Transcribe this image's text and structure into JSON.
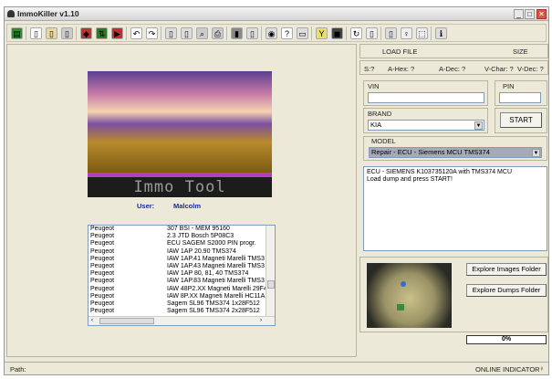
{
  "window": {
    "title": "ImmoKiller v1.10",
    "minimize": "_",
    "maximize": "□",
    "close": "✕"
  },
  "toolbar": {
    "icons": [
      "memory-icon",
      "new-file-icon",
      "open-icon",
      "save-icon",
      "read-icon",
      "transfer-icon",
      "write-icon",
      "undo-icon",
      "redo-icon",
      "copy-icon",
      "paste-icon",
      "find-icon",
      "print-icon",
      "calculator-icon",
      "device-icon",
      "hex-icon",
      "help-icon",
      "book-icon",
      "tools-icon",
      "chip-icon",
      "refresh-icon",
      "split-icon",
      "page-icon",
      "pin-icon",
      "select-icon",
      "info-icon"
    ]
  },
  "banner": {
    "logo_text": "Immo Tool",
    "user_label": "User:",
    "user_name": "Malcolm"
  },
  "list": {
    "rows": [
      [
        "Peugeot",
        "307  BSI - MEM 95160"
      ],
      [
        "Peugeot",
        "2.3 JTD Bosch 5P08C3"
      ],
      [
        "Peugeot",
        "ECU SAGEM S2000   PIN progr."
      ],
      [
        "Peugeot",
        "IAW 1AP 20.90 TMS374"
      ],
      [
        "Peugeot",
        "IAW 1AP.41 Magneti Marelli TMS3"
      ],
      [
        "Peugeot",
        "IAW 1AP.43 Magneti Marelli TMS3"
      ],
      [
        "Peugeot",
        "IAW 1AP 80, 81, 40 TMS374"
      ],
      [
        "Peugeot",
        "IAW 1AP.83 Magneti Marelli TMS3"
      ],
      [
        "Peugeot",
        "IAW 48P2.XX Magneti Marelli 29F4"
      ],
      [
        "Peugeot",
        "IAW 8P.XX Magneti Marelli HC11A"
      ],
      [
        "Peugeot",
        "Sagem SL96 TMS374 1x28F512"
      ],
      [
        "Peugeot",
        "Sagem SL96 TMS374 2x28F512"
      ]
    ]
  },
  "file": {
    "load_file": "LOAD FILE",
    "size": "SIZE",
    "s": "S:?",
    "a_hex": "A-Hex: ?",
    "a_dec": "A-Dec: ?",
    "v_char": "V-Char: ?",
    "v_dec": "V-Dec: ?"
  },
  "form": {
    "vin_label": "VIN",
    "vin_value": "",
    "pin_label": "PIN",
    "pin_value": "",
    "brand_label": "BRAND",
    "brand_value": "KIA",
    "start": "START",
    "model_label": "MODEL",
    "model_value": "Repair - ECU - Siemens MCU TMS374"
  },
  "info": {
    "line1": "ECU - SIEMENS K103735120A with TMS374 MCU",
    "line2": "Load dump and press START!"
  },
  "buttons": {
    "images": "Explore Images Folder",
    "dumps": "Explore Dumps Folder"
  },
  "progress": {
    "percent": 0,
    "label": "0%"
  },
  "status": {
    "path": "Path:",
    "online": "ONLINE INDICATOR"
  }
}
